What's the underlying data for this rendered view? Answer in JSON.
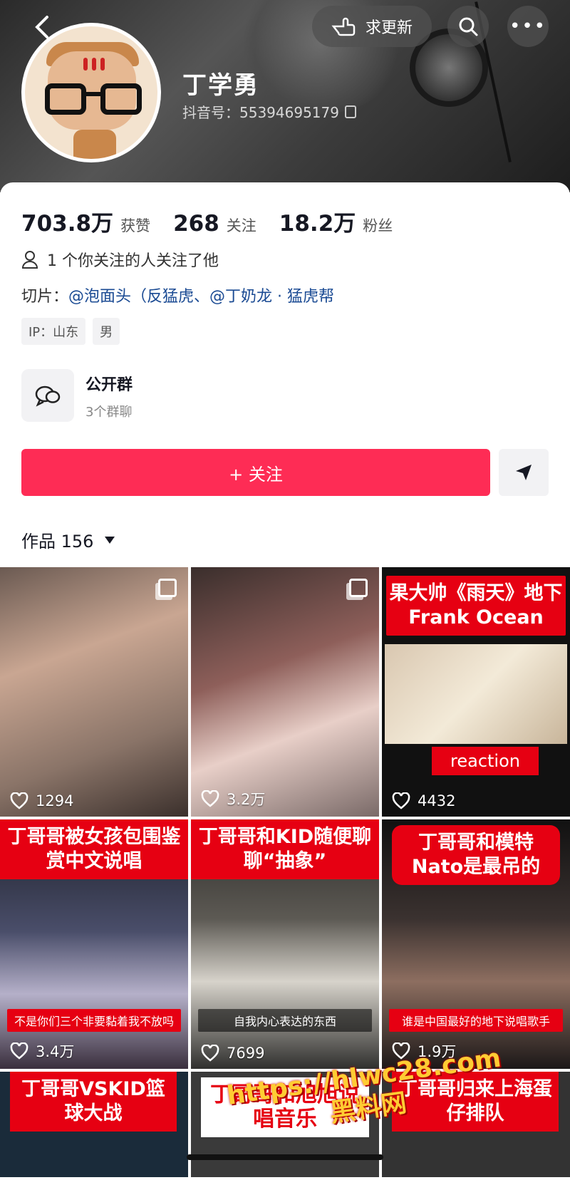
{
  "header": {
    "back_icon": "chevron-left-icon",
    "update_label": "求更新",
    "update_icon": "pointing-hand-icon",
    "search_icon": "search-icon",
    "more_icon": "more-dots-icon",
    "more_glyph": "•••"
  },
  "profile": {
    "name": "丁学勇",
    "douyin_id": "抖音号：55394695179"
  },
  "stats": [
    {
      "value": "703.8万",
      "label": "获赞"
    },
    {
      "value": "268",
      "label": "关注"
    },
    {
      "value": "18.2万",
      "label": "粉丝"
    }
  ],
  "mutual_text": "1 个你关注的人关注了他",
  "clips": {
    "prefix": "切片：",
    "link1": "@泡面头（反猛虎",
    "sep": "、",
    "link2": "@丁奶龙 · 猛虎帮"
  },
  "tags": [
    "IP：山东",
    "男"
  ],
  "group": {
    "title": "公开群",
    "subtitle": "3个群聊"
  },
  "follow_label": "+ 关注",
  "works": {
    "label": "作品 156"
  },
  "videos": [
    {
      "likes": "1294",
      "title": "",
      "subtitle": ""
    },
    {
      "likes": "3.2万",
      "title": "",
      "subtitle": ""
    },
    {
      "likes": "4432",
      "title": "果大帅《雨天》地下Frank Ocean",
      "subtitle": "reaction"
    },
    {
      "likes": "3.4万",
      "title": "丁哥哥被女孩包围鉴赏中文说唱",
      "subtitle": "不是你们三个非要黏着我不放吗"
    },
    {
      "likes": "7699",
      "title": "丁哥哥和KID随便聊聊“抽象”",
      "subtitle": "自我内心表达的东西"
    },
    {
      "likes": "1.9万",
      "title": "丁哥哥和模特Nato是最吊的",
      "subtitle": "谁是中国最好的地下说唱歌手"
    },
    {
      "likes": "",
      "title": "丁哥哥VSKID篮球大战",
      "subtitle": ""
    },
    {
      "likes": "",
      "title": "丁哥哥和旭旭说唱音乐",
      "subtitle": ""
    },
    {
      "likes": "",
      "title": "丁哥哥归来上海蛋仔排队",
      "subtitle": ""
    }
  ],
  "watermark": {
    "line1": "https://hlwc28.com",
    "line2": "黑料网"
  },
  "colors": {
    "accent": "#fe2c55",
    "link": "#1a4a93",
    "title_red": "#e60012"
  }
}
